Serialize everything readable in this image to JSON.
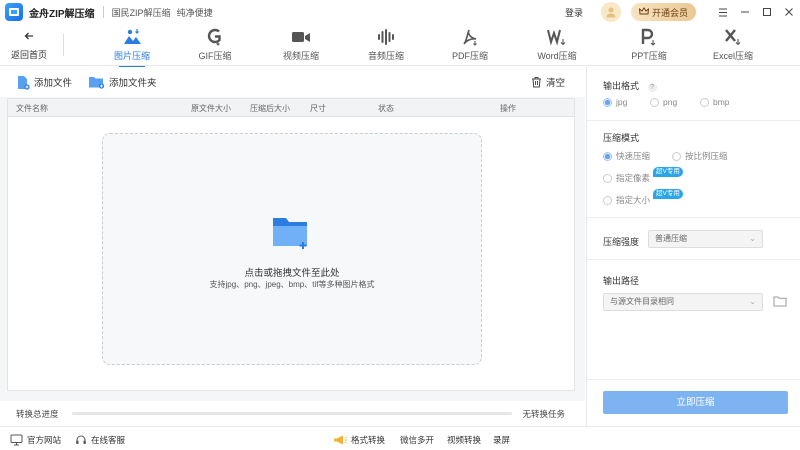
{
  "app": {
    "title": "金舟ZIP解压缩",
    "subtitle": "国民ZIP解压缩",
    "slogan": "纯净便捷"
  },
  "titlebar": {
    "login": "登录",
    "vip": "开通会员"
  },
  "toolbar": {
    "back": "返回首页",
    "tabs": [
      {
        "label": "图片压缩",
        "icon": "image-compress-icon",
        "active": true
      },
      {
        "label": "GIF压缩",
        "icon": "gif-icon"
      },
      {
        "label": "视频压缩",
        "icon": "video-icon"
      },
      {
        "label": "音频压缩",
        "icon": "audio-icon"
      },
      {
        "label": "PDF压缩",
        "icon": "pdf-icon"
      },
      {
        "label": "Word压缩",
        "icon": "word-icon"
      },
      {
        "label": "PPT压缩",
        "icon": "ppt-icon"
      },
      {
        "label": "Excel压缩",
        "icon": "excel-icon"
      }
    ]
  },
  "actions": {
    "add_file": "添加文件",
    "add_folder": "添加文件夹",
    "clear": "清空"
  },
  "table": {
    "columns": [
      "文件名称",
      "原文件大小",
      "压缩后大小",
      "尺寸",
      "状态",
      "操作"
    ]
  },
  "dropzone": {
    "title": "点击或拖拽文件至此处",
    "hint": "支持jpg、png、jpeg、bmp、tif等多种图片格式"
  },
  "progress": {
    "label": "转换总进度",
    "status": "无转换任务",
    "value": 0
  },
  "settings": {
    "output_format": {
      "label": "输出格式",
      "options": [
        "jpg",
        "png",
        "bmp"
      ],
      "selected": "jpg"
    },
    "mode": {
      "label": "压缩模式",
      "options": [
        "快速压缩",
        "按比例压缩",
        "指定像素",
        "指定大小"
      ],
      "selected": "快速压缩",
      "badge": "超V专用"
    },
    "strength": {
      "label": "压缩强度",
      "value": "普通压缩"
    },
    "path": {
      "label": "输出路径",
      "value": "与源文件目录相同"
    },
    "start": "立即压缩"
  },
  "footer": {
    "website": "官方网站",
    "service": "在线客服",
    "links": [
      "格式转换",
      "微信多开",
      "视频转换",
      "录屏"
    ]
  },
  "colors": {
    "accent": "#2a7de1",
    "button": "#7db3f0",
    "badge": "#2aa5e8"
  }
}
